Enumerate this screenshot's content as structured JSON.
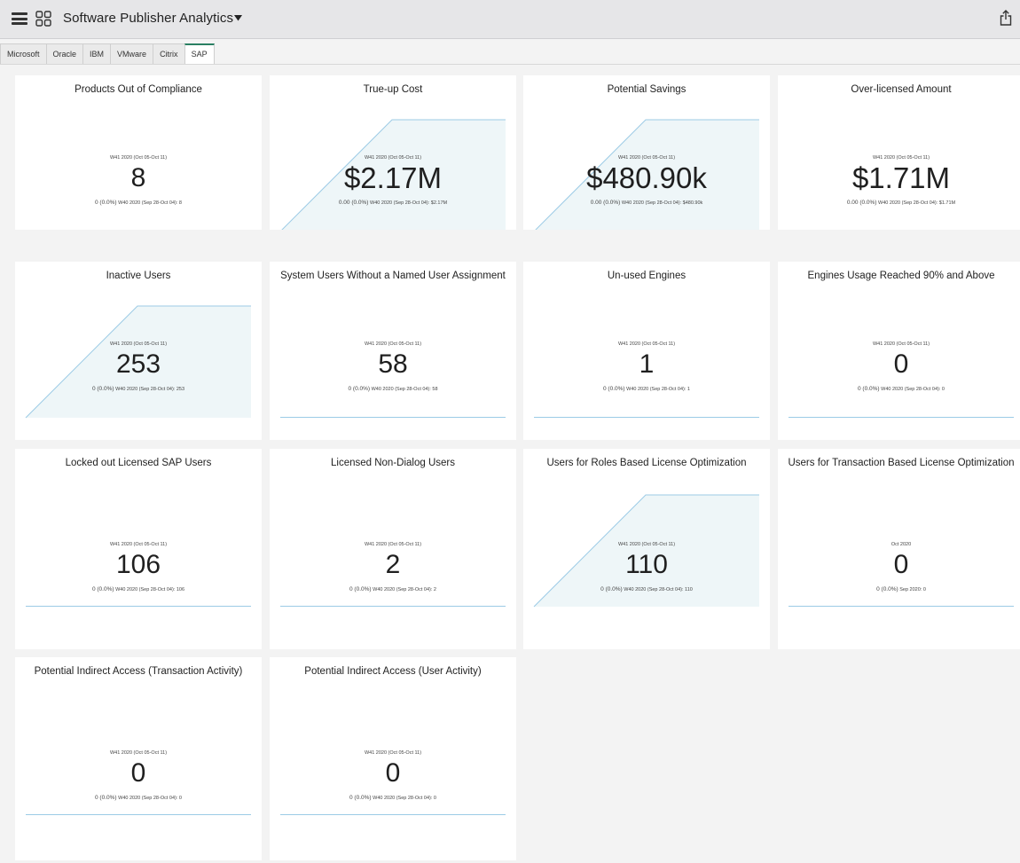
{
  "header": {
    "title": "Software Publisher Analytics",
    "menu_icon": "hamburger-menu-icon",
    "apps_icon": "app-grid-icon",
    "dropdown_icon": "caret-down-icon",
    "share_icon": "share-export-icon"
  },
  "tabs": [
    {
      "label": "Microsoft",
      "active": false
    },
    {
      "label": "Oracle",
      "active": false
    },
    {
      "label": "IBM",
      "active": false
    },
    {
      "label": "VMware",
      "active": false
    },
    {
      "label": "Citrix",
      "active": false
    },
    {
      "label": "SAP",
      "active": true
    }
  ],
  "colors": {
    "accent": "#2a7f62",
    "sparkline": "#9ccbe6",
    "sparkline_fill": "#eef6f8"
  },
  "cards": [
    {
      "title": "Products Out of Compliance",
      "period": "W41 2020 (Oct 05-Oct 11)",
      "value": "8",
      "delta": "0 (0.0%)",
      "prev": "W40 2020 (Sep 28-Oct 04): 8",
      "trend": "flat"
    },
    {
      "title": "True-up Cost",
      "period": "W41 2020 (Oct 05-Oct 11)",
      "value": "$2.17M",
      "delta": "0.00 (0.0%)",
      "prev": "W40 2020 (Sep 28-Oct 04): $2.17M",
      "trend": "up"
    },
    {
      "title": "Potential Savings",
      "period": "W41 2020 (Oct 05-Oct 11)",
      "value": "$480.90k",
      "delta": "0.00 (0.0%)",
      "prev": "W40 2020 (Sep 28-Oct 04): $480.90k",
      "trend": "up"
    },
    {
      "title": "Over-licensed Amount",
      "period": "W41 2020 (Oct 05-Oct 11)",
      "value": "$1.71M",
      "delta": "0.00 (0.0%)",
      "prev": "W40 2020 (Sep 28-Oct 04): $1.71M",
      "trend": "flat"
    },
    {
      "title": "Inactive Users",
      "period": "W41 2020 (Oct 05-Oct 11)",
      "value": "253",
      "delta": "0 (0.0%)",
      "prev": "W40 2020 (Sep 28-Oct 04): 253",
      "trend": "up"
    },
    {
      "title": "System Users Without a Named User Assignment",
      "period": "W41 2020 (Oct 05-Oct 11)",
      "value": "58",
      "delta": "0 (0.0%)",
      "prev": "W40 2020 (Sep 28-Oct 04): 58",
      "trend": "flat"
    },
    {
      "title": "Un-used Engines",
      "period": "W41 2020 (Oct 05-Oct 11)",
      "value": "1",
      "delta": "0 (0.0%)",
      "prev": "W40 2020 (Sep 28-Oct 04): 1",
      "trend": "flat"
    },
    {
      "title": "Engines Usage Reached 90% and Above",
      "period": "W41 2020 (Oct 05-Oct 11)",
      "value": "0",
      "delta": "0 (0.0%)",
      "prev": "W40 2020 (Sep 28-Oct 04): 0",
      "trend": "flat"
    },
    {
      "title": "Locked out Licensed SAP Users",
      "period": "W41 2020 (Oct 05-Oct 11)",
      "value": "106",
      "delta": "0 (0.0%)",
      "prev": "W40 2020 (Sep 28-Oct 04): 106",
      "trend": "flat"
    },
    {
      "title": "Licensed Non-Dialog Users",
      "period": "W41 2020 (Oct 05-Oct 11)",
      "value": "2",
      "delta": "0 (0.0%)",
      "prev": "W40 2020 (Sep 28-Oct 04): 2",
      "trend": "flat"
    },
    {
      "title": "Users for Roles Based License Optimization",
      "period": "W41 2020 (Oct 05-Oct 11)",
      "value": "110",
      "delta": "0 (0.0%)",
      "prev": "W40 2020 (Sep 28-Oct 04): 110",
      "trend": "up"
    },
    {
      "title": "Users for Transaction Based License Optimization",
      "period": "Oct 2020",
      "value": "0",
      "delta": "0 (0.0%)",
      "prev": "Sep 2020: 0",
      "trend": "flat"
    },
    {
      "title": "Potential Indirect Access (Transaction Activity)",
      "period": "W41 2020 (Oct 05-Oct 11)",
      "value": "0",
      "delta": "0 (0.0%)",
      "prev": "W40 2020 (Sep 28-Oct 04): 0",
      "trend": "flat"
    },
    {
      "title": "Potential Indirect Access (User Activity)",
      "period": "W41 2020 (Oct 05-Oct 11)",
      "value": "0",
      "delta": "0 (0.0%)",
      "prev": "W40 2020 (Sep 28-Oct 04): 0",
      "trend": "flat"
    }
  ]
}
